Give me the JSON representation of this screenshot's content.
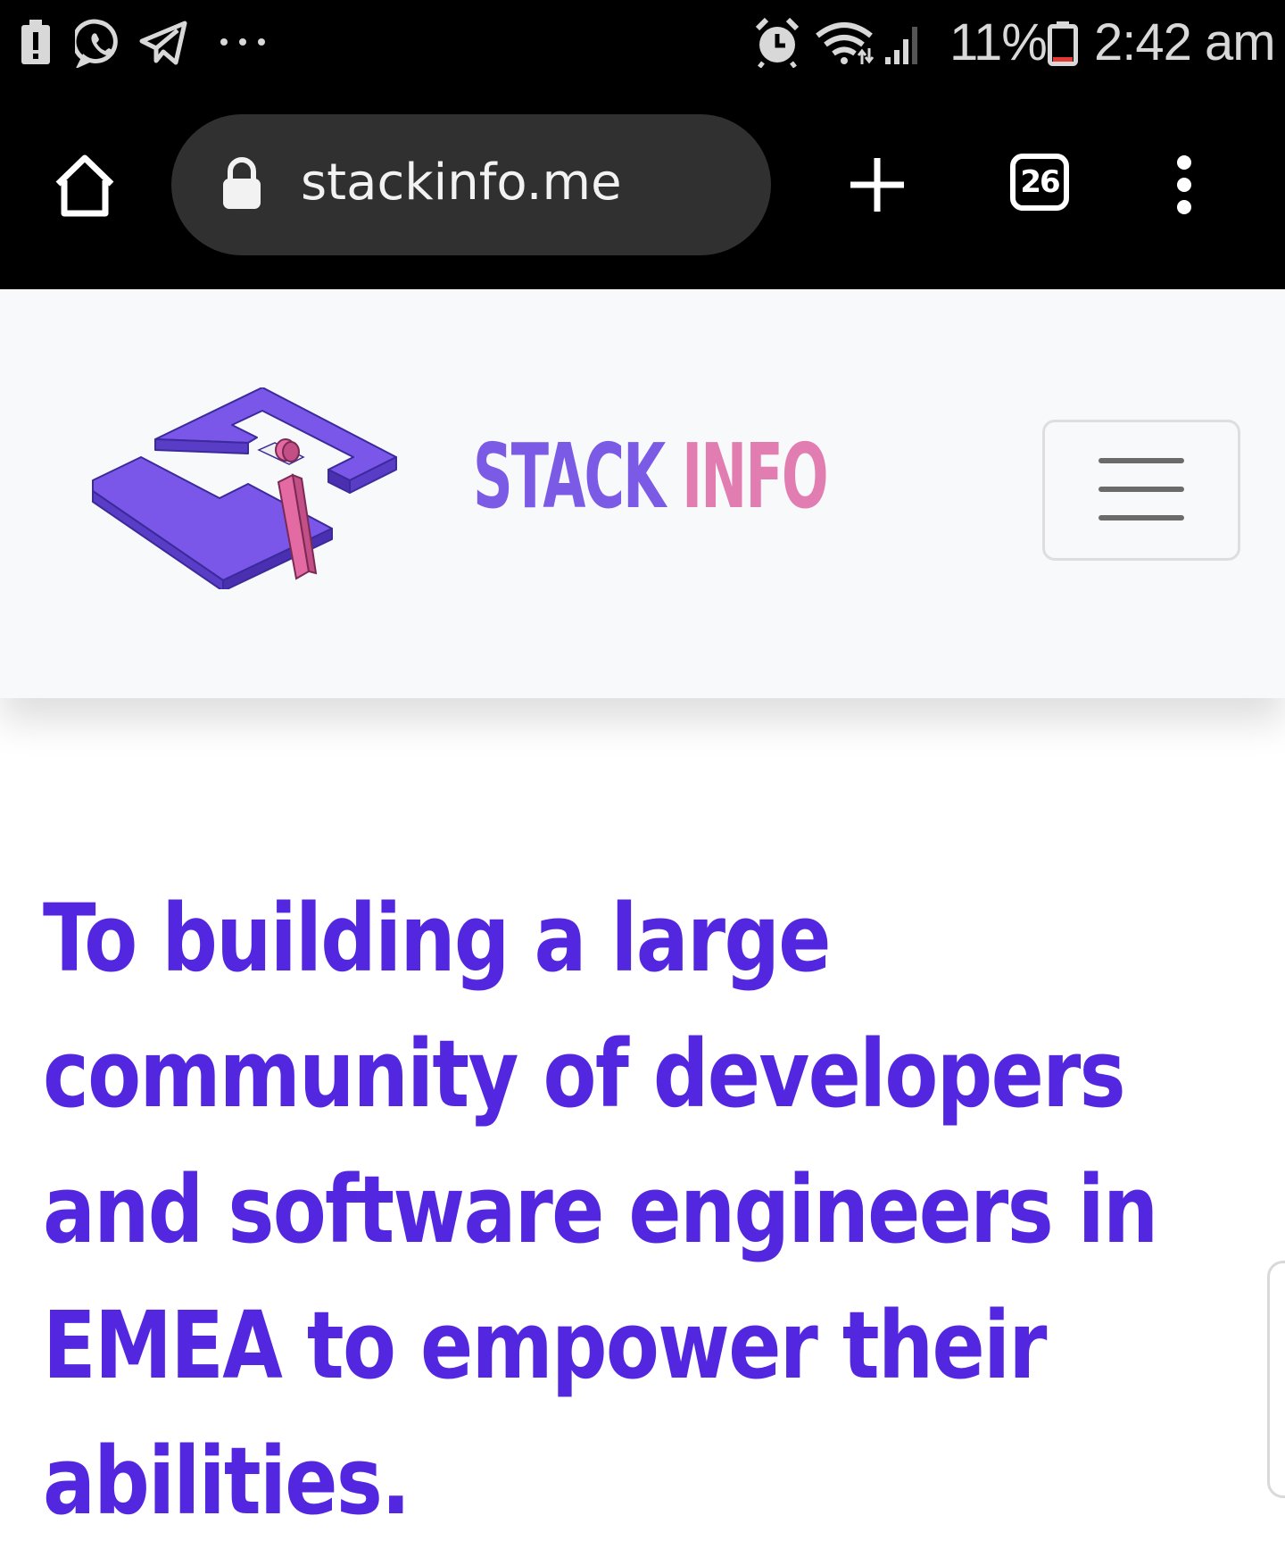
{
  "status_bar": {
    "battery_percent_label": "11%",
    "time": "2:42 am",
    "notification_icons": [
      "battery-alert-icon",
      "whatsapp-icon",
      "telegram-icon",
      "more-notifications-icon"
    ],
    "system_icons": [
      "alarm-icon",
      "wifi-icon",
      "signal-icon",
      "battery-icon"
    ]
  },
  "browser": {
    "url": "stackinfo.me",
    "tab_count": "26"
  },
  "site": {
    "brand_part1": "STACK",
    "brand_part2": " INFO",
    "colors": {
      "brand_purple": "#7b5be6",
      "brand_pink": "#e27db2",
      "headline": "#5326e0"
    }
  },
  "hero": {
    "headline": "To building a large community of developers and software engineers in EMEA to empower their abilities."
  }
}
